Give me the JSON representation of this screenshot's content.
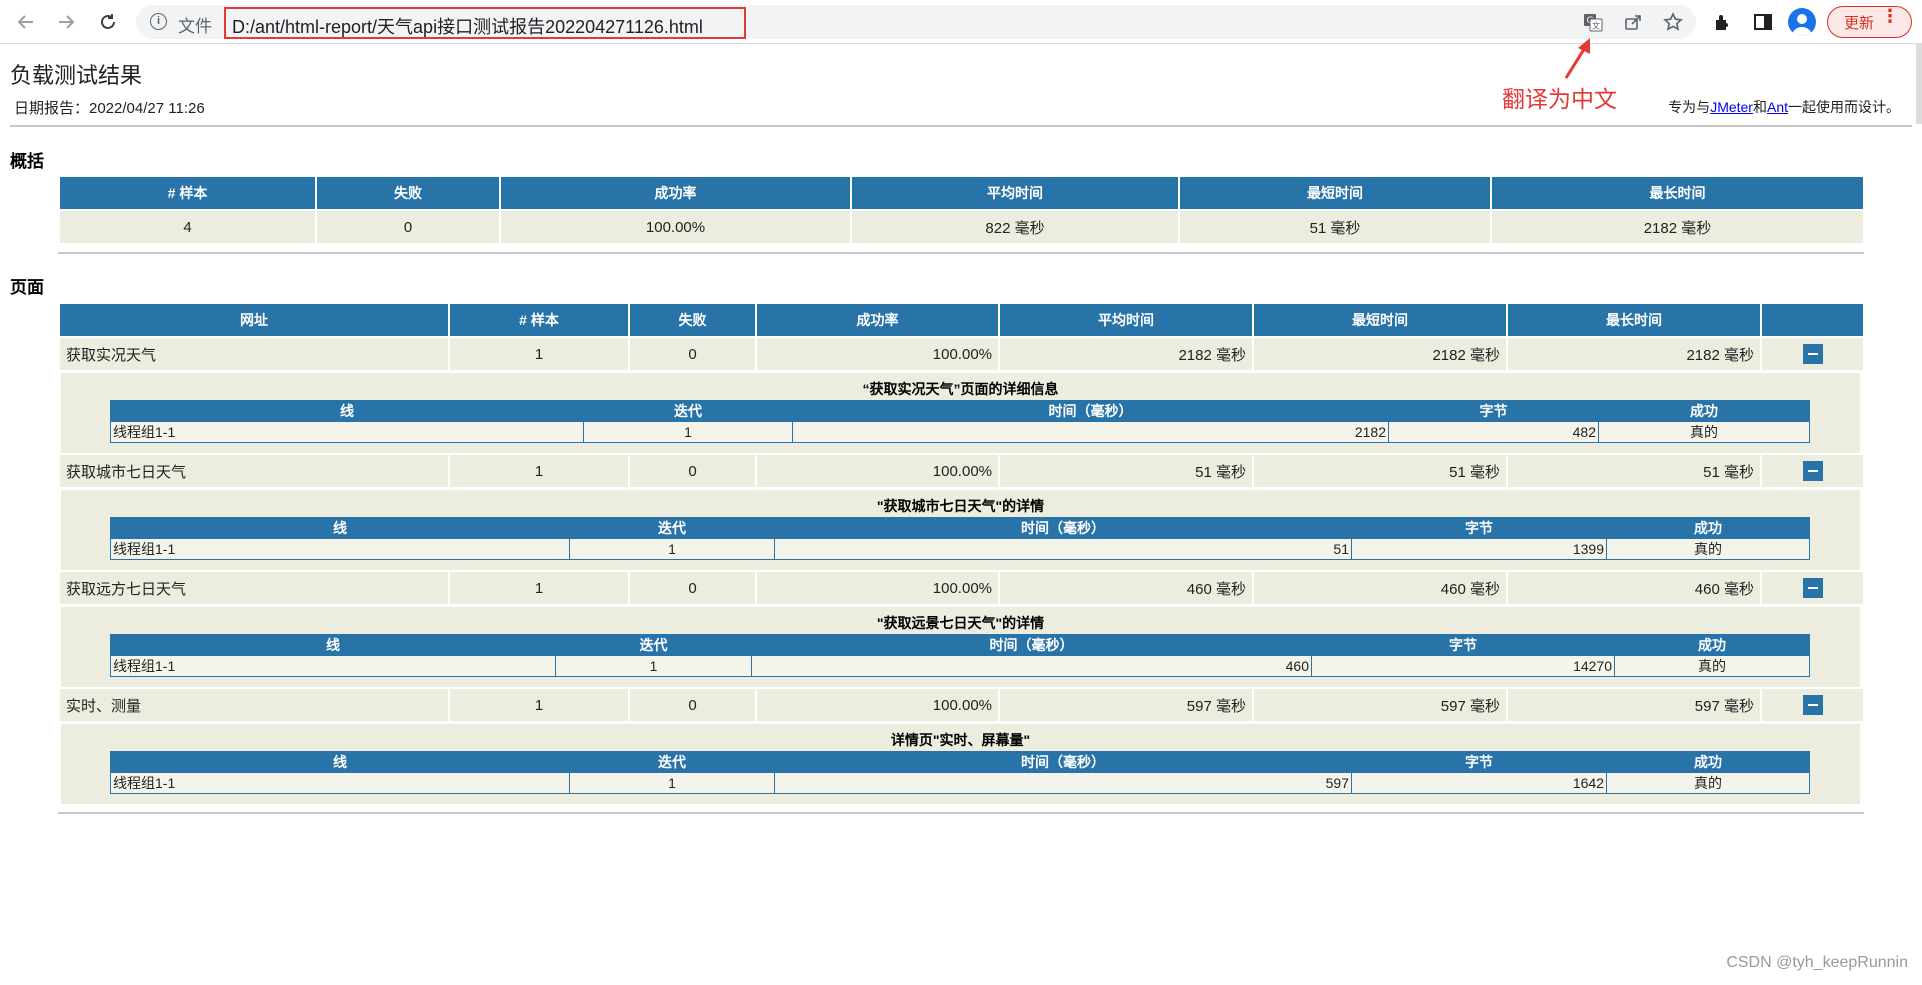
{
  "browser": {
    "file_label": "文件",
    "url": "D:/ant/html-report/天气api接口测试报告202204271126.html",
    "update_label": "更新"
  },
  "annotation": {
    "text": "翻译为中文"
  },
  "report": {
    "title": "负载测试结果",
    "date": "日期报告：2022/04/27 11:26",
    "note_prefix": "专为与",
    "note_link1": "JMeter",
    "note_mid": "和",
    "note_link2": "Ant",
    "note_suffix": "一起使用而设计。"
  },
  "summary": {
    "heading": "概括",
    "headers": [
      "# 样本",
      "失败",
      "成功率",
      "平均时间",
      "最短时间",
      "最长时间"
    ],
    "row": [
      "4",
      "0",
      "100.00%",
      "822 毫秒",
      "51 毫秒",
      "2182 毫秒"
    ]
  },
  "pages": {
    "heading": "页面",
    "headers": [
      "网址",
      "# 样本",
      "失败",
      "成功率",
      "平均时间",
      "最短时间",
      "最长时间",
      ""
    ],
    "detail_headers": [
      "线",
      "迭代",
      "时间（毫秒）",
      "字节",
      "成功"
    ],
    "rows": [
      {
        "name": "获取实况天气",
        "samples": "1",
        "failures": "0",
        "rate": "100.00%",
        "avg": "2182 毫秒",
        "min": "2182 毫秒",
        "max": "2182 毫秒",
        "detail_title": "“获取实况天气”页面的详细信息",
        "detail": {
          "thread": "线程组1-1",
          "iteration": "1",
          "time": "2182",
          "bytes": "482",
          "success": "真的"
        }
      },
      {
        "name": "获取城市七日天气",
        "samples": "1",
        "failures": "0",
        "rate": "100.00%",
        "avg": "51 毫秒",
        "min": "51 毫秒",
        "max": "51 毫秒",
        "detail_title": "\"获取城市七日天气\"的详情",
        "detail": {
          "thread": "线程组1-1",
          "iteration": "1",
          "time": "51",
          "bytes": "1399",
          "success": "真的"
        }
      },
      {
        "name": "获取远方七日天气",
        "samples": "1",
        "failures": "0",
        "rate": "100.00%",
        "avg": "460 毫秒",
        "min": "460 毫秒",
        "max": "460 毫秒",
        "detail_title": "\"获取远景七日天气\"的详情",
        "detail": {
          "thread": "线程组1-1",
          "iteration": "1",
          "time": "460",
          "bytes": "14270",
          "success": "真的"
        }
      },
      {
        "name": "实时、测量",
        "samples": "1",
        "failures": "0",
        "rate": "100.00%",
        "avg": "597 毫秒",
        "min": "597 毫秒",
        "max": "597 毫秒",
        "detail_title": "详情页\"实时、屏幕量\"",
        "detail": {
          "thread": "线程组1-1",
          "iteration": "1",
          "time": "597",
          "bytes": "1642",
          "success": "真的"
        }
      }
    ]
  },
  "watermark": "CSDN @tyh_keepRunnin"
}
